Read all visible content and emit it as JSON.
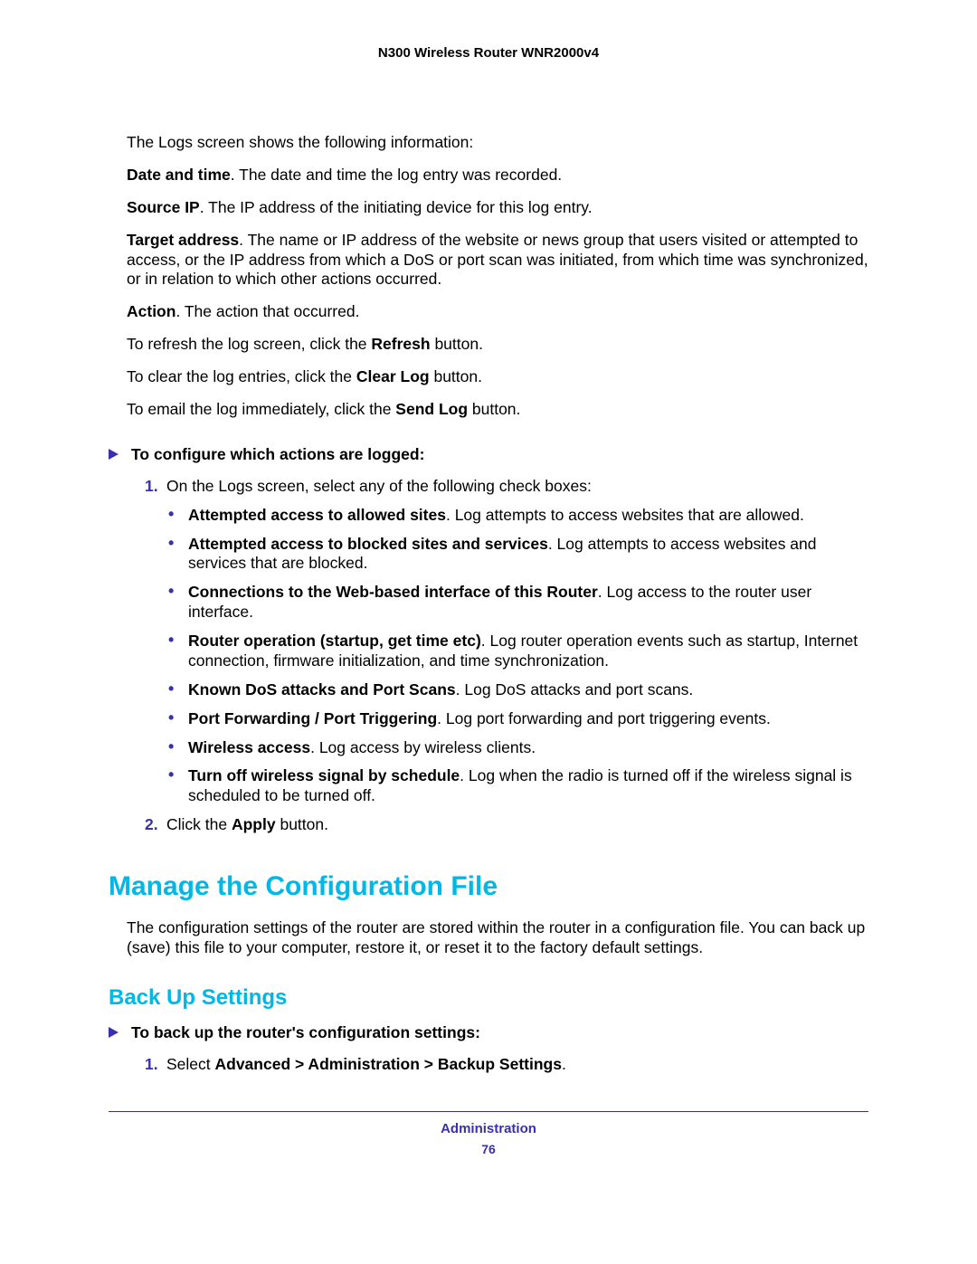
{
  "header": {
    "title": "N300 Wireless Router WNR2000v4"
  },
  "intro": "The Logs screen shows the following information:",
  "defs": {
    "dt_label": "Date and time",
    "dt_text": ". The date and time the log entry was recorded.",
    "sip_label": "Source IP",
    "sip_text": ". The IP address of the initiating device for this log entry.",
    "ta_label": "Target address",
    "ta_text": ". The name or IP address of the website or news group that users visited or attempted to access, or the IP address from which a DoS or port scan was initiated, from which time was synchronized, or in relation to which other actions occurred.",
    "act_label": "Action",
    "act_text": ". The action that occurred."
  },
  "refresh": {
    "pre": "To refresh the log screen, click the ",
    "btn": "Refresh",
    "post": " button."
  },
  "clear": {
    "pre": "To clear the log entries, click the ",
    "btn": "Clear Log",
    "post": " button."
  },
  "send": {
    "pre": "To email the log immediately, click the ",
    "btn": "Send Log",
    "post": " button."
  },
  "task1": {
    "heading": "To configure which actions are logged:",
    "step1": {
      "num": "1.",
      "text": "On the Logs screen, select any of the following check boxes:"
    },
    "bullets": [
      {
        "b": "Attempted access to allowed sites",
        "t": ". Log attempts to access websites that are allowed."
      },
      {
        "b": "Attempted access to blocked sites and services",
        "t": ". Log attempts to access websites and services that are blocked."
      },
      {
        "b": "Connections to the Web-based interface of this Router",
        "t": ". Log access to the router user interface."
      },
      {
        "b": "Router operation (startup, get time etc)",
        "t": ". Log router operation events such as startup, Internet connection, firmware initialization, and time synchronization."
      },
      {
        "b": "Known DoS attacks and Port Scans",
        "t": ". Log DoS attacks and port scans."
      },
      {
        "b": "Port Forwarding / Port Triggering",
        "t": ". Log port forwarding and port triggering events."
      },
      {
        "b": "Wireless access",
        "t": ". Log access by wireless clients."
      },
      {
        "b": "Turn off wireless signal by schedule",
        "t": ". Log when the radio is turned off if the wireless signal is scheduled to be turned off."
      }
    ],
    "step2": {
      "num": "2.",
      "pre": "Click the ",
      "btn": "Apply",
      "post": " button."
    }
  },
  "h1": "Manage the Configuration File",
  "h1_para": "The configuration settings of the router are stored within the router in a configuration file. You can back up (save) this file to your computer, restore it, or reset it to the factory default settings.",
  "h2": "Back Up Settings",
  "task2": {
    "heading": "To back up the router's configuration settings:",
    "step1": {
      "num": "1.",
      "pre": "Select ",
      "path": "Advanced > Administration > Backup Settings",
      "post": "."
    }
  },
  "footer": {
    "section": "Administration",
    "page": "76"
  }
}
